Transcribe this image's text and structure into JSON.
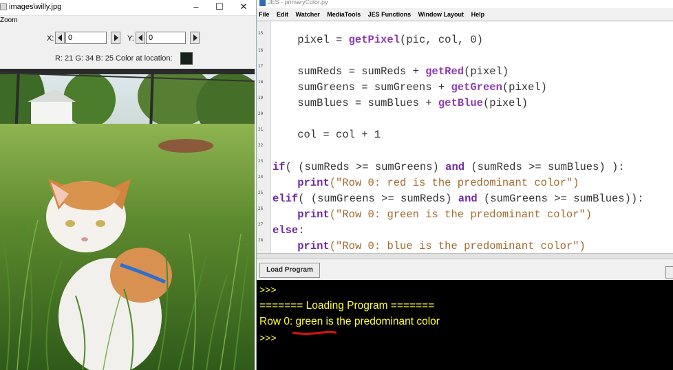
{
  "picture_window": {
    "title": "images\\willy.jpg",
    "controls": {
      "minimize": "–",
      "maximize": "☐",
      "close": "✕"
    },
    "menu": "Zoom",
    "x_label": "X:",
    "x_value": "0",
    "y_label": "Y:",
    "y_value": "0",
    "color_text": "R: 21 G: 34 B: 25 Color at location:",
    "swatch_color": "#152219"
  },
  "jes_window": {
    "title": "JES - primaryColor.py",
    "menu": [
      "File",
      "Edit",
      "Watcher",
      "MediaTools",
      "JES Functions",
      "Window Layout",
      "Help"
    ],
    "line_numbers": [
      "15",
      "16",
      "17",
      "18",
      "19",
      "20",
      "21",
      "22",
      "23",
      "24",
      "25",
      "26",
      "27",
      "28"
    ],
    "code": {
      "l1_a": "    pixel = ",
      "l1_fn": "getPixel",
      "l1_b": "(pic, col, 0)",
      "l2_a": "    sumReds = sumReds + ",
      "l2_fn": "getRed",
      "l2_b": "(pixel)",
      "l3_a": "    sumGreens = sumGreens + ",
      "l3_fn": "getGreen",
      "l3_b": "(pixel)",
      "l4_a": "    sumBlues = sumBlues + ",
      "l4_fn": "getBlue",
      "l4_b": "(pixel)",
      "l5": "    col = col + 1",
      "l6_kw1": "if",
      "l6_a": "( (sumReds >= sumGreens) ",
      "l6_kw2": "and",
      "l6_b": " (sumReds >= sumBlues) ):",
      "l7_kw": "print",
      "l7_str": "(\"Row 0: red is the predominant color\")",
      "l8_kw1": "elif",
      "l8_a": "( (sumGreens >= sumReds) ",
      "l8_kw2": "and",
      "l8_b": " (sumGreens >= sumBlues)):",
      "l9_kw": "print",
      "l9_str": "(\"Row 0: green is the predominant color\")",
      "l10_kw": "else",
      "l10_a": ":",
      "l11_kw": "print",
      "l11_str": "(\"Row 0: blue is the predominant color\")"
    },
    "load_button": "Load Program",
    "console": {
      "prompt1": ">>>",
      "loading": "======= Loading Program =======",
      "output": "Row 0: green is the predominant color",
      "prompt2": ">>>"
    }
  }
}
